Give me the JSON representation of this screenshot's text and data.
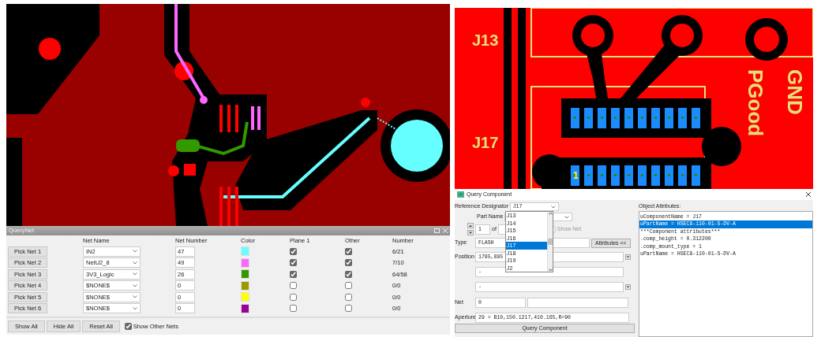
{
  "query_net": {
    "title": "QueryNet",
    "headers": [
      "Net Name",
      "Net Number",
      "Color",
      "Plane 1",
      "Other",
      "Number"
    ],
    "rows": [
      {
        "button": "Pick Net 1",
        "net_name": "IN2",
        "net_number": "47",
        "color": "#66ffff",
        "plane_1": true,
        "other": true,
        "number": "6/21"
      },
      {
        "button": "Pick Net 2",
        "net_name": "NetU2_8",
        "net_number": "49",
        "color": "#ff66ff",
        "plane_1": true,
        "other": true,
        "number": "7/10"
      },
      {
        "button": "Pick Net 3",
        "net_name": "3V3_Logic",
        "net_number": "26",
        "color": "#339900",
        "plane_1": true,
        "other": true,
        "number": "64/58"
      },
      {
        "button": "Pick Net 4",
        "net_name": "$NONE$",
        "net_number": "0",
        "color": "#999900",
        "plane_1": false,
        "other": false,
        "number": "0/0"
      },
      {
        "button": "Pick Net 5",
        "net_name": "$NONE$",
        "net_number": "0",
        "color": "#ffff00",
        "plane_1": false,
        "other": false,
        "number": "0/0"
      },
      {
        "button": "Pick Net 6",
        "net_name": "$NONE$",
        "net_number": "0",
        "color": "#990099",
        "plane_1": false,
        "other": false,
        "number": "0/0"
      }
    ],
    "buttons": [
      "Show All",
      "Hide All",
      "Reset All"
    ],
    "show_other_nets": {
      "label": "Show Other Nets",
      "checked": true
    }
  },
  "board_view": {
    "labels": [
      {
        "text": "J13",
        "kind": "ref"
      },
      {
        "text": "J17",
        "kind": "ref"
      },
      {
        "text": "PGood",
        "kind": "net"
      },
      {
        "text": "GND",
        "kind": "net"
      },
      {
        "text": "1",
        "kind": "pin"
      }
    ]
  },
  "query_component": {
    "title": "Query Component",
    "reference_designator": {
      "label": "Reference Designator",
      "value": "J17",
      "options": [
        {
          "text": "J13",
          "selected": false
        },
        {
          "text": "J14",
          "selected": false
        },
        {
          "text": "J15",
          "selected": false
        },
        {
          "text": "J16",
          "selected": false
        },
        {
          "text": "J17",
          "selected": true
        },
        {
          "text": "J18",
          "selected": false
        },
        {
          "text": "J19",
          "selected": false
        },
        {
          "text": "J2",
          "selected": false
        }
      ]
    },
    "part_name": {
      "label": "Part Name"
    },
    "index": {
      "value": "1",
      "of_label": "of"
    },
    "show_net": {
      "label": "Show Net",
      "checked": false,
      "disabled": true
    },
    "type": {
      "label": "Type",
      "value": "FLASH"
    },
    "attributes_button": "Attributes <<",
    "position": {
      "label": "Position",
      "value": "1795,895"
    },
    "field_1": {
      "value": "-"
    },
    "field_2": {
      "value": "-"
    },
    "net": {
      "label": "Net",
      "value": "0"
    },
    "aperture": {
      "label": "Aperture",
      "value": "29 = B10,150.1217,410.165,R=90"
    },
    "query_button": "Query Component",
    "object_attributes": {
      "label": "Object Attributes:",
      "lines": [
        {
          "text": "uComponentName = J17",
          "selected": false
        },
        {
          "text": "uPartName = HSEC8-110-01-S-DV-A",
          "selected": true
        },
        {
          "text": "***Component attributes***",
          "selected": false
        },
        {
          "text": ".comp_height = 0.312200",
          "selected": false
        },
        {
          "text": ".comp_mount_type = 1",
          "selected": false
        },
        {
          "text": "uPartName = HSEC8-110-01-S-DV-A",
          "selected": false
        }
      ]
    }
  }
}
